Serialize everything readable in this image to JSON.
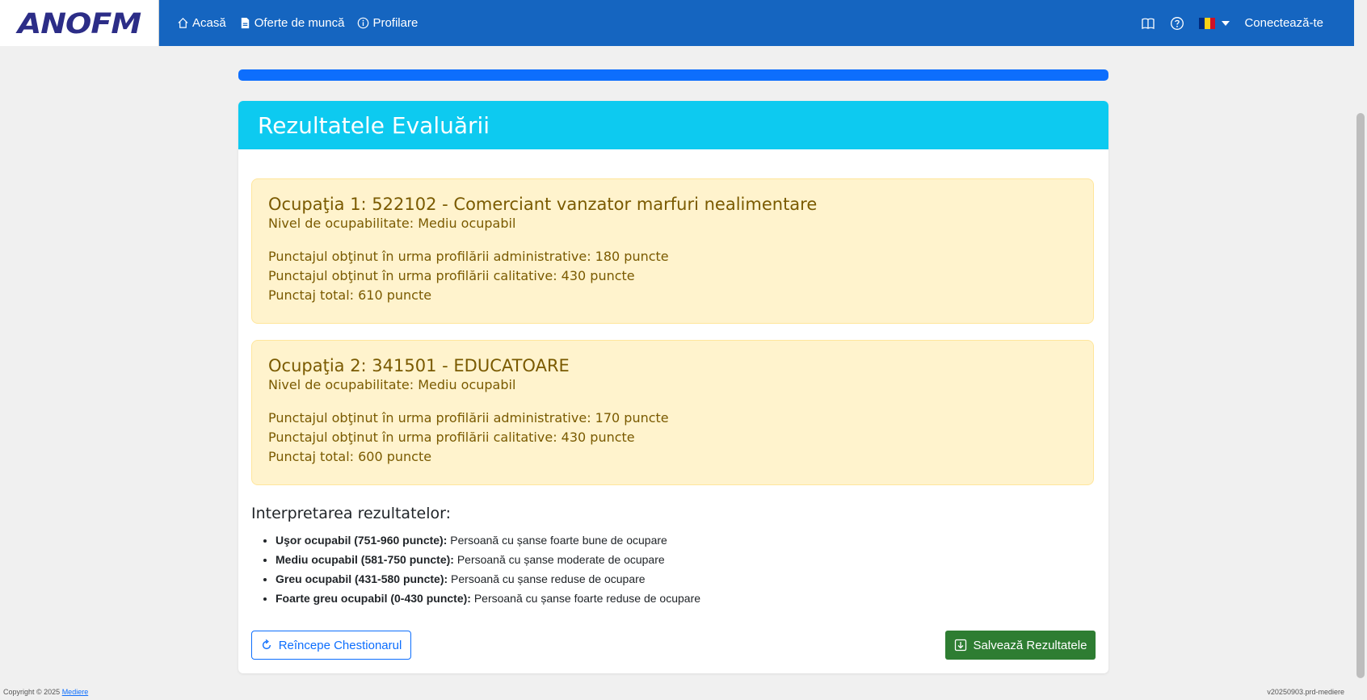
{
  "nav": {
    "logo": "ANOFM",
    "links": [
      {
        "label": "Acasă",
        "icon": "home-icon"
      },
      {
        "label": "Oferte de muncă",
        "icon": "document-icon"
      },
      {
        "label": "Profilare",
        "icon": "info-icon"
      }
    ],
    "login": "Conectează-te"
  },
  "card": {
    "title": "Rezultatele Evaluării",
    "occupations": [
      {
        "title": "Ocupaţia 1: 522102 - Comerciant vanzator marfuri nealimentare",
        "level": "Nivel de ocupabilitate: Mediu ocupabil",
        "admin": "Punctajul obţinut în urma profilării administrative: 180 puncte",
        "qual": "Punctajul obţinut în urma profilării calitative: 430 puncte",
        "total": "Punctaj total: 610 puncte"
      },
      {
        "title": "Ocupaţia 2: 341501 - EDUCATOARE",
        "level": "Nivel de ocupabilitate: Mediu ocupabil",
        "admin": "Punctajul obţinut în urma profilării administrative: 170 puncte",
        "qual": "Punctajul obţinut în urma profilării calitative: 430 puncte",
        "total": "Punctaj total: 600 puncte"
      }
    ],
    "interpretation_title": "Interpretarea rezultatelor:",
    "interpretation": [
      {
        "label": "Uşor ocupabil (751-960 puncte):",
        "text": " Persoană cu șanse foarte bune de ocupare"
      },
      {
        "label": "Mediu ocupabil (581-750 puncte):",
        "text": " Persoană cu șanse moderate de ocupare"
      },
      {
        "label": "Greu ocupabil (431-580 puncte):",
        "text": " Persoană cu șanse reduse de ocupare"
      },
      {
        "label": "Foarte greu ocupabil (0-430 puncte):",
        "text": " Persoană cu șanse foarte reduse de ocupare"
      }
    ],
    "restart_button": "Reîncepe Chestionarul",
    "save_button": "Salvează Rezultatele"
  },
  "footer": {
    "copyright": "Copyright © 2025 ",
    "link": "Mediere",
    "version": "v20250903.prd-mediere"
  },
  "colors": {
    "navbar": "#1565c0",
    "header": "#0dcaf0",
    "alert_bg": "#fff3cd",
    "save_button": "#2e7d32"
  }
}
